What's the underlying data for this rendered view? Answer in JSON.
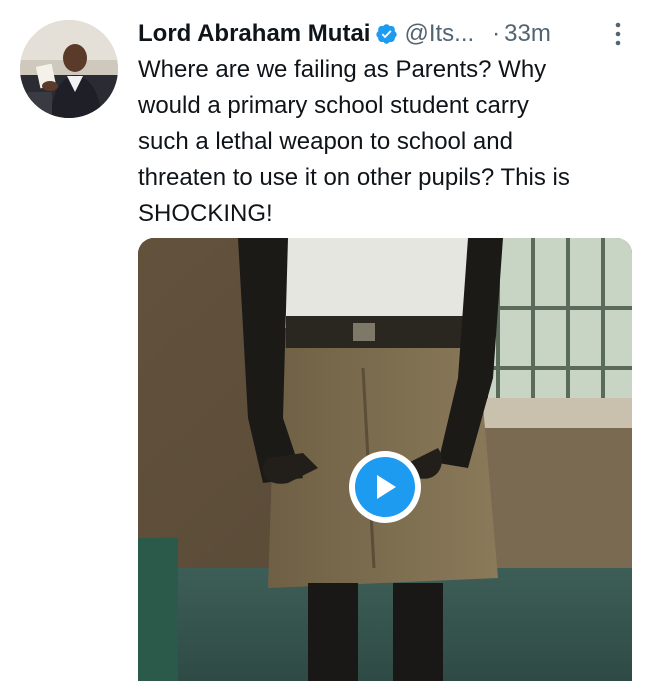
{
  "tweet": {
    "author_name": "Lord Abraham Mutai",
    "handle": "@Its...",
    "separator": "·",
    "time": "33m",
    "text_lines": [
      "Where are we failing as Parents? Why",
      "would a primary school student carry",
      "such a lethal weapon to school and",
      "threaten to use it on other pupils? This is",
      "SHOCKING!"
    ],
    "icons": {
      "verified": "verified-badge-icon",
      "more": "more-vertical-icon",
      "play": "play-icon"
    }
  },
  "colors": {
    "accent": "#1d9bf0",
    "text_primary": "#0f1419",
    "text_secondary": "#536471"
  }
}
